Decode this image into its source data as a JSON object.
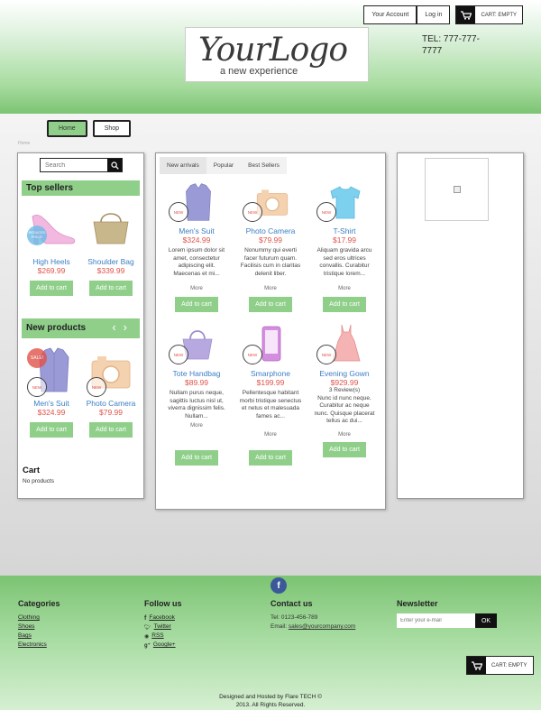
{
  "header": {
    "account_label": "Your Account",
    "login_label": "Log in",
    "cart_label": "CART: EMPTY",
    "logo_main": "YourLogo",
    "logo_tagline": "a new experience",
    "phone": "TEL: 777-777-7777"
  },
  "nav": {
    "home": "Home",
    "shop": "Shop"
  },
  "breadcrumb": "Home",
  "sidebar": {
    "search_placeholder": "Search",
    "top_sellers_title": "Top sellers",
    "top_sellers": [
      {
        "name": "High Heels",
        "price": "$269.99",
        "badge": "REDUCED PRICE!",
        "add": "Add to cart"
      },
      {
        "name": "Shoulder Bag",
        "price": "$339.99",
        "add": "Add to cart"
      }
    ],
    "new_products_title": "New products",
    "new_products": [
      {
        "name": "Men's Suit",
        "price": "$324.99",
        "sale": "SALE!",
        "new": "NEW",
        "add": "Add to cart"
      },
      {
        "name": "Photo Camera",
        "price": "$79.99",
        "new": "NEW",
        "add": "Add to cart"
      }
    ],
    "cart_title": "Cart",
    "cart_empty": "No products"
  },
  "main": {
    "tabs": [
      "New arrivals",
      "Popular",
      "Best Sellers"
    ],
    "products": [
      {
        "name": "Men's Suit",
        "price": "$324.99",
        "desc": "Lorem ipsum dolor sit amet, consectetur adipiscing elit. Maecenas et mi...",
        "more": "More",
        "add": "Add to cart",
        "new": "NEW",
        "icon": "shirt-icon"
      },
      {
        "name": "Photo Camera",
        "price": "$79.99",
        "desc": "Nonummy qui everti facer futurum quam. Facilisis cum in claritas delenit liber.",
        "more": "More",
        "add": "Add to cart",
        "new": "NEW",
        "icon": "camera-icon"
      },
      {
        "name": "T-Shirt",
        "price": "$17.99",
        "desc": "Aliquam gravida arcu sed eros ultrices convallis. Curabitur tristique lorem...",
        "more": "More",
        "add": "Add to cart",
        "new": "NEW",
        "icon": "tshirt-icon"
      },
      {
        "name": "Tote Handbag",
        "price": "$89.99",
        "desc": "Nullam purus neque, sagittis luctus nisl ut, viverra dignissim felis. Nullam...",
        "more": "More",
        "add": "Add to cart",
        "new": "NEW",
        "icon": "handbag-icon"
      },
      {
        "name": "Smarphone",
        "price": "$199.99",
        "desc": "Pellentesque habitant morbi tristique senectus et netus et malesuada fames ac...",
        "more": "More",
        "add": "Add to cart",
        "new": "NEW",
        "icon": "phone-icon"
      },
      {
        "name": "Evening Gown",
        "price": "$929.99",
        "reviews": "3 Review(s)",
        "desc": "Nunc id nunc neque. Curabitur ac neque nunc. Quisque placerat tellus ac dui...",
        "more": "More",
        "add": "Add to cart",
        "new": "NEW",
        "icon": "dress-icon"
      }
    ]
  },
  "footer": {
    "fb_icon": "f",
    "categories_title": "Categories",
    "categories": [
      "Clothing",
      "Shoes",
      "Bags",
      "Electronics"
    ],
    "follow_title": "Follow us",
    "follow": [
      "Facebook",
      "Twitter",
      "RSS",
      "Google+"
    ],
    "contact_title": "Contact us",
    "tel": "Tel: 0123-456-789",
    "email_label": "Email:",
    "email": "sales@yourcompany.com",
    "newsletter_title": "Newsletter",
    "newsletter_placeholder": "Enter your e-mail",
    "ok_label": "OK",
    "cart_label": "CART: EMPTY",
    "copyright_1": "Designed and Hosted by Flare TECH ©",
    "copyright_2": "2013. All Rights Reserved."
  },
  "colors": {
    "accent": "#8fcf8a",
    "price": "#e0534a",
    "link": "#3b7fc4"
  }
}
